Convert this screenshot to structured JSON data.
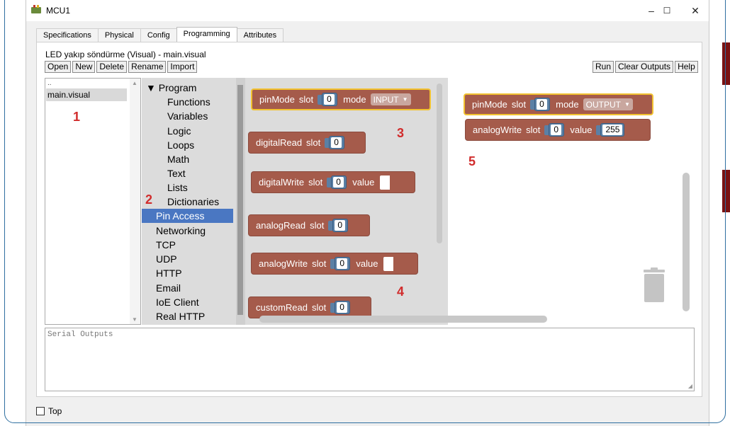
{
  "window": {
    "title": "MCU1",
    "minimize": "–",
    "maximize": "☐",
    "close": "✕"
  },
  "tabs": [
    "Specifications",
    "Physical",
    "Config",
    "Programming",
    "Attributes"
  ],
  "active_tab": "Programming",
  "file_title": "LED yakıp söndürme (Visual) - main.visual",
  "toolbar_left": [
    "Open",
    "New",
    "Delete",
    "Rename",
    "Import"
  ],
  "toolbar_right": [
    "Run",
    "Clear Outputs",
    "Help"
  ],
  "file_list": {
    "parent": "..",
    "items": [
      "main.visual"
    ]
  },
  "categories": {
    "program_header": "▼ Program",
    "program_children": [
      "Functions",
      "Variables",
      "Logic",
      "Loops",
      "Math",
      "Text",
      "Lists",
      "Dictionaries"
    ],
    "selected": "Pin Access",
    "others": [
      "Networking",
      "TCP",
      "UDP",
      "HTTP",
      "Email",
      "IoE Client",
      "Real HTTP"
    ]
  },
  "flyout_blocks": {
    "pinmode": {
      "label": "pinMode",
      "slot": "slot",
      "slot_value": "0",
      "mode": "mode",
      "mode_value": "INPUT"
    },
    "digitalread": {
      "label": "digitalRead",
      "slot": "slot",
      "slot_value": "0"
    },
    "digitalwrite": {
      "label": "digitalWrite",
      "slot": "slot",
      "slot_value": "0",
      "value": "value"
    },
    "analogread": {
      "label": "analogRead",
      "slot": "slot",
      "slot_value": "0"
    },
    "analogwrite": {
      "label": "analogWrite",
      "slot": "slot",
      "slot_value": "0",
      "value": "value"
    },
    "customread": {
      "label": "customRead",
      "slot": "slot",
      "slot_value": "0"
    }
  },
  "workspace_blocks": {
    "pinmode": {
      "label": "pinMode",
      "slot": "slot",
      "slot_value": "0",
      "mode": "mode",
      "mode_value": "OUTPUT"
    },
    "analogwrite": {
      "label": "analogWrite",
      "slot": "slot",
      "slot_value": "0",
      "value": "value",
      "value_value": "255"
    }
  },
  "annotations": [
    "1",
    "2",
    "3",
    "4",
    "5"
  ],
  "serial_placeholder": "Serial Outputs",
  "footer": {
    "top_label": "Top"
  },
  "colors": {
    "block": "#a55b4b",
    "slot": "#5b80a5",
    "highlight": "#f2c230",
    "selection": "#4a77c2",
    "annotation": "#d12c2c"
  }
}
